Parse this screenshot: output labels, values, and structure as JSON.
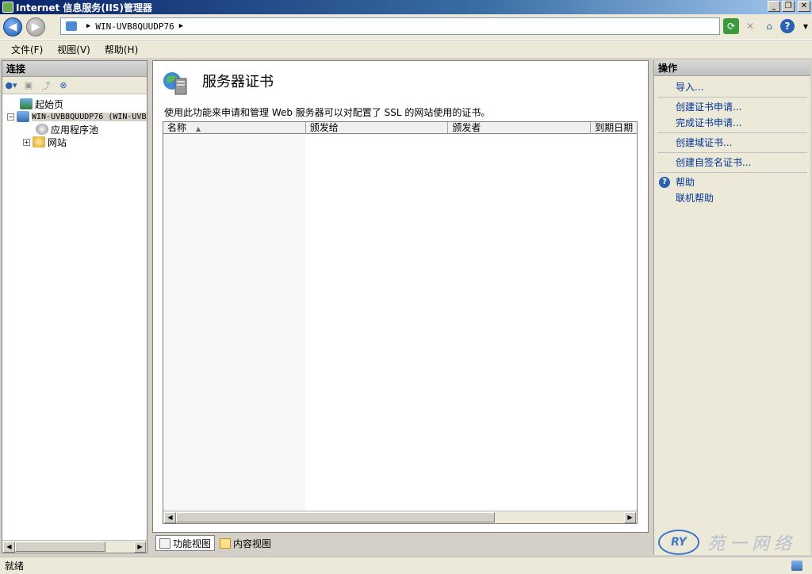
{
  "window": {
    "title": "Internet 信息服务(IIS)管理器",
    "controls": {
      "minimize": "_",
      "maximize": "❐",
      "close": "✕"
    }
  },
  "address": {
    "path": "WIN-UVB8QUUDP76",
    "separator": "▶"
  },
  "menu": {
    "items": [
      "文件(F)",
      "视图(V)",
      "帮助(H)"
    ]
  },
  "connections": {
    "header": "连接",
    "tree": {
      "start_page": "起始页",
      "server": "WIN-UVB8QUUDP76 (WIN-UVB",
      "app_pools": "应用程序池",
      "sites": "网站"
    }
  },
  "feature": {
    "title": "服务器证书",
    "description": "使用此功能来申请和管理 Web 服务器可以对配置了 SSL 的网站使用的证书。",
    "columns": [
      "名称",
      "颁发给",
      "颁发者",
      "到期日期"
    ],
    "sort_indicator": "▲"
  },
  "view_tabs": {
    "features_view": "功能视图",
    "content_view": "内容视图"
  },
  "actions": {
    "header": "操作",
    "items": {
      "import": "导入...",
      "create_request": "创建证书申请...",
      "complete_request": "完成证书申请...",
      "create_domain_cert": "创建域证书...",
      "create_self_signed": "创建自签名证书...",
      "help": "帮助",
      "online_help": "联机帮助"
    }
  },
  "status": {
    "text": "就绪"
  },
  "watermark": {
    "logo": "RY",
    "text": "苑一网络"
  },
  "colors": {
    "title_bar": "#0a246a",
    "link": "#003399",
    "panel_bg": "#ece9d8"
  }
}
